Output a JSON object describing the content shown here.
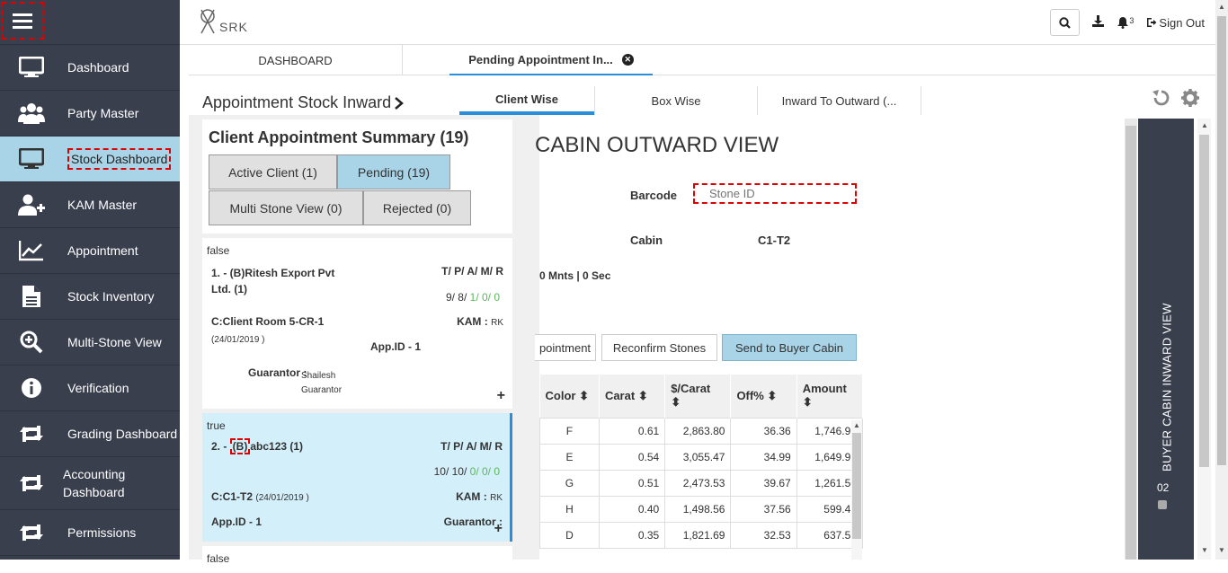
{
  "sidebar": {
    "items": [
      {
        "label": "Dashboard",
        "icon": "monitor-icon"
      },
      {
        "label": "Party Master",
        "icon": "users-icon"
      },
      {
        "label": "Stock Dashboard",
        "icon": "monitor-icon"
      },
      {
        "label": "KAM Master",
        "icon": "user-plus-icon"
      },
      {
        "label": "Appointment",
        "icon": "line-chart-icon"
      },
      {
        "label": "Stock Inventory",
        "icon": "document-icon"
      },
      {
        "label": "Multi-Stone View",
        "icon": "zoom-in-icon"
      },
      {
        "label": "Verification",
        "icon": "info-icon"
      },
      {
        "label": "Grading Dashboard",
        "icon": "retweet-icon"
      },
      {
        "label": "Accounting Dashboard",
        "icon": "retweet-icon"
      },
      {
        "label": "Permissions",
        "icon": "retweet-icon"
      }
    ],
    "active_index": 2
  },
  "topbar": {
    "logo_text": "SRK",
    "notification_count": "3",
    "signout_label": "Sign Out"
  },
  "tabs": [
    {
      "label": "DASHBOARD"
    },
    {
      "label": "Pending Appointment In..."
    }
  ],
  "page": {
    "title": "Appointment Stock Inward",
    "subtabs": [
      "Client Wise",
      "Box Wise",
      "Inward To Outward (..."
    ]
  },
  "summary": {
    "title": "Client Appointment Summary (19)",
    "buttons": [
      "Active Client (1)",
      "Pending (19)",
      "Multi Stone View (0)",
      "Rejected (0)"
    ]
  },
  "cards": [
    {
      "flag": "false",
      "name": "1. - (B)Ritesh Export Pvt Ltd. (1)",
      "tpamr_label": "T/ P/ A/ M/ R",
      "counts_prefix": "9/ 8/ ",
      "counts_green": "1/ 0/ 0",
      "room": "C:Client Room 5-CR-1",
      "date": "(24/01/2019 )",
      "kam_label": "KAM :",
      "kam_value": "RK",
      "app_id": "App.ID - 1",
      "guarantor_label": "Guarantor :",
      "guarantor_value": "Shailesh Guarantor"
    },
    {
      "flag": "true",
      "name_prefix": "2. - ",
      "name_hl": "(B)",
      "name_rest": "abc123 (1)",
      "tpamr_label": "T/ P/ A/ M/ R",
      "counts_prefix": "10/ 10/ ",
      "counts_green": "0/ 0/ 0",
      "room": "C:C1-T2",
      "date": "(24/01/2019 )",
      "kam_label": "KAM :",
      "kam_value": "RK",
      "app_id": "App.ID - 1",
      "guarantor_label": "Guarantor :"
    },
    {
      "flag": "false"
    }
  ],
  "main": {
    "title": "CABIN OUTWARD VIEW",
    "barcode_label": "Barcode",
    "barcode_placeholder": "Stone ID",
    "cabin_label": "Cabin",
    "cabin_value": "C1-T2",
    "timer": "0 Mnts | 0 Sec",
    "actions": [
      "pointment",
      "Reconfirm Stones",
      "Send to Buyer Cabin"
    ]
  },
  "table": {
    "headers": [
      "Color",
      "Carat",
      "$/Carat",
      "Off%",
      "Amount"
    ],
    "rows": [
      [
        "F",
        "0.61",
        "2,863.80",
        "36.36",
        "1,746.92"
      ],
      [
        "E",
        "0.54",
        "3,055.47",
        "34.99",
        "1,649.95"
      ],
      [
        "G",
        "0.51",
        "2,473.53",
        "39.67",
        "1,261.50"
      ],
      [
        "H",
        "0.40",
        "1,498.56",
        "37.56",
        "599.42"
      ],
      [
        "D",
        "0.35",
        "1,821.69",
        "32.53",
        "637.59"
      ]
    ]
  },
  "side_panel": {
    "title": "BUYER CABIN INWARD VIEW",
    "number": "02"
  }
}
